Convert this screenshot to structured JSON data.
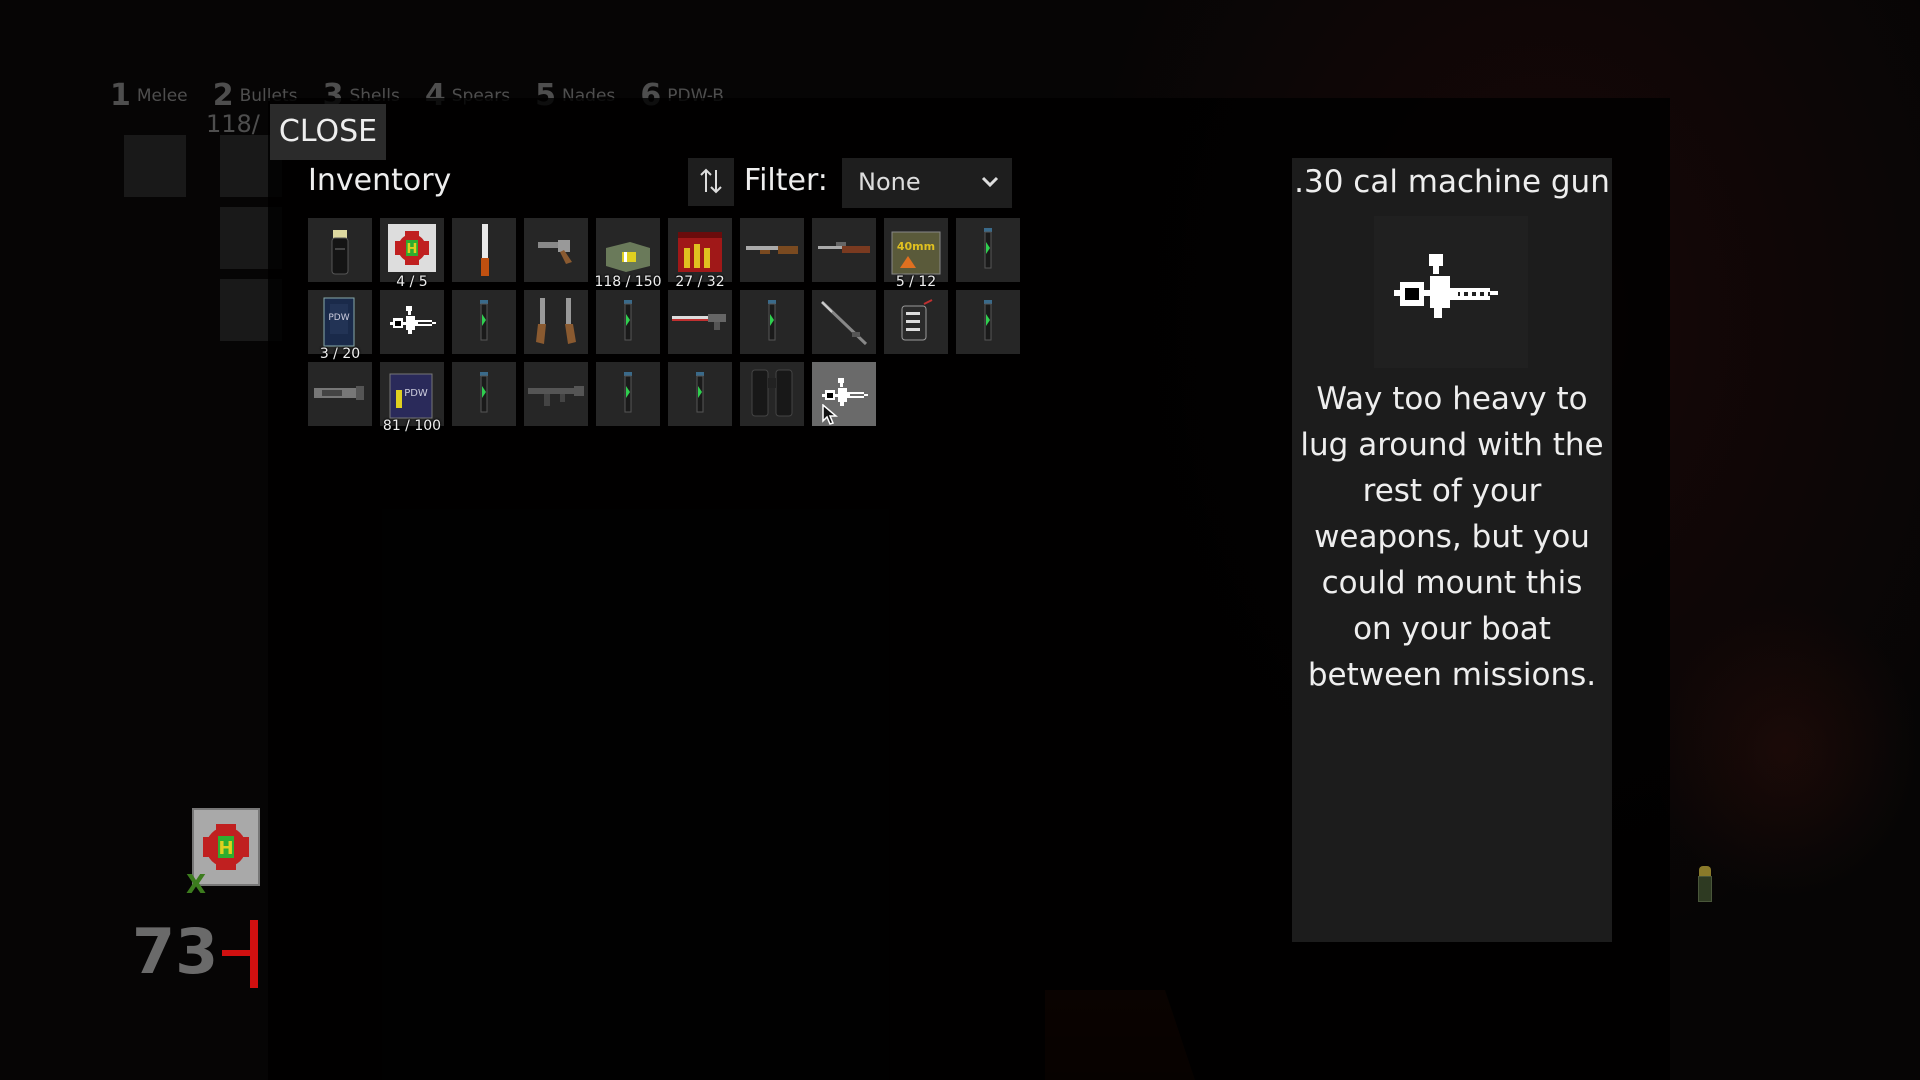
{
  "hud": {
    "categories": [
      {
        "num": "1",
        "label": "Melee"
      },
      {
        "num": "2",
        "label": "Bullets"
      },
      {
        "num": "3",
        "label": "Shells"
      },
      {
        "num": "4",
        "label": "Spears"
      },
      {
        "num": "5",
        "label": "Nades"
      },
      {
        "num": "6",
        "label": "PDW-B"
      }
    ],
    "ammo_partial": "118/",
    "health_value": "73",
    "use_key": "X",
    "health_color": "#d01010"
  },
  "close_label": "CLOSE",
  "inventory": {
    "title": "Inventory",
    "sort_icon": "sort-arrows-icon",
    "filter_label": "Filter:",
    "filter_value": "None",
    "items": [
      {
        "name": "flashlight",
        "icon": "flashlight-icon",
        "count": "",
        "selected": false
      },
      {
        "name": "medkit",
        "icon": "medkit-icon",
        "count": "4 / 5",
        "selected": false
      },
      {
        "name": "machete",
        "icon": "machete-icon",
        "count": "",
        "selected": false
      },
      {
        "name": "revolver",
        "icon": "revolver-icon",
        "count": "",
        "selected": false
      },
      {
        "name": "bullets-ammo-box",
        "icon": "ammo-box-icon",
        "count": "118 / 150",
        "selected": false
      },
      {
        "name": "shells-ammo-box",
        "icon": "shells-box-icon",
        "count": "27 / 32",
        "selected": false
      },
      {
        "name": "shotgun",
        "icon": "shotgun-icon",
        "count": "",
        "selected": false
      },
      {
        "name": "rifle",
        "icon": "rifle-icon",
        "count": "",
        "selected": false
      },
      {
        "name": "grenades-ammo-box",
        "icon": "grenade-box-icon",
        "count": "5 / 12",
        "selected": false
      },
      {
        "name": "green-vial",
        "icon": "vial-icon",
        "count": "",
        "selected": false
      },
      {
        "name": "pdw-magazine",
        "icon": "magazine-icon",
        "count": "3 / 20",
        "selected": false
      },
      {
        "name": "machine-gun",
        "icon": "machine-gun-icon",
        "count": "",
        "selected": false
      },
      {
        "name": "green-vial",
        "icon": "vial-icon",
        "count": "",
        "selected": false
      },
      {
        "name": "dual-pistols",
        "icon": "dual-pistols-icon",
        "count": "",
        "selected": false
      },
      {
        "name": "green-vial",
        "icon": "vial-icon",
        "count": "",
        "selected": false
      },
      {
        "name": "spear-gun",
        "icon": "speargun-icon",
        "count": "",
        "selected": false
      },
      {
        "name": "green-vial",
        "icon": "vial-icon",
        "count": "",
        "selected": false
      },
      {
        "name": "fishing-rod",
        "icon": "rod-icon",
        "count": "",
        "selected": false
      },
      {
        "name": "pdw",
        "icon": "pdw-icon",
        "count": "",
        "selected": false
      },
      {
        "name": "green-vial",
        "icon": "vial-icon",
        "count": "",
        "selected": false
      },
      {
        "name": "grenade-launcher",
        "icon": "launcher-icon",
        "count": "",
        "selected": false
      },
      {
        "name": "pdw-ammo-box",
        "icon": "pdw-ammo-icon",
        "count": "81 / 100",
        "selected": false
      },
      {
        "name": "green-vial",
        "icon": "vial-icon",
        "count": "",
        "selected": false
      },
      {
        "name": "assault-rifle",
        "icon": "assault-rifle-icon",
        "count": "",
        "selected": false
      },
      {
        "name": "green-vial",
        "icon": "vial-icon",
        "count": "",
        "selected": false
      },
      {
        "name": "green-vial",
        "icon": "vial-icon",
        "count": "",
        "selected": false
      },
      {
        "name": "binoculars",
        "icon": "binoculars-icon",
        "count": "",
        "selected": false
      },
      {
        "name": "machine-gun",
        "icon": "machine-gun-icon",
        "count": "",
        "selected": true
      }
    ]
  },
  "details": {
    "title": ".30 cal machine gun",
    "icon": "machine-gun-icon",
    "description": "Way too heavy to lug around with the rest of your weapons, but you could mount this on your boat between missions."
  }
}
